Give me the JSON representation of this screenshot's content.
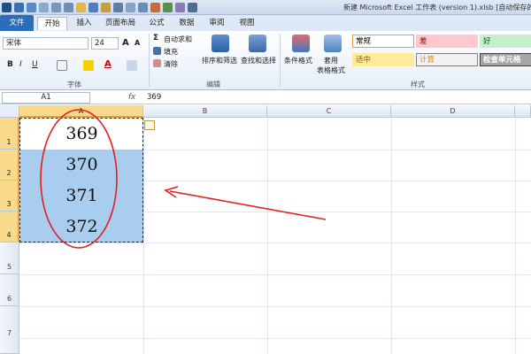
{
  "window": {
    "title": "新建 Microsoft Excel 工作表 (version 1).xlsb [自动保存的"
  },
  "tabs": [
    {
      "label": "文件"
    },
    {
      "label": "开始"
    },
    {
      "label": "插入"
    },
    {
      "label": "页面布局"
    },
    {
      "label": "公式"
    },
    {
      "label": "数据"
    },
    {
      "label": "审阅"
    },
    {
      "label": "视图"
    }
  ],
  "ribbon": {
    "font": {
      "name": "宋体",
      "size": "24",
      "grow": "A",
      "shrink": "A",
      "bold": "B",
      "italic": "I",
      "underline": "U",
      "color_letter": "A",
      "group_label": "字体"
    },
    "editing": {
      "autosum": "自动求和",
      "fill": "填充",
      "clear": "清除",
      "sort_filter": "排序和筛选",
      "find_select": "查找和选择",
      "group_label": "编辑"
    },
    "styles": {
      "conditional": "条件格式",
      "table_format_1": "套用",
      "table_format_2": "表格格式",
      "cells": [
        {
          "label": "常规",
          "bg": "#ffffff",
          "fg": "#000000",
          "border": "#e2a23b"
        },
        {
          "label": "差",
          "bg": "#ffc7ce",
          "fg": "#9c0006",
          "border": "#ffc7ce"
        },
        {
          "label": "好",
          "bg": "#c6efce",
          "fg": "#006100",
          "border": "#c6efce"
        },
        {
          "label": "适中",
          "bg": "#ffeb9c",
          "fg": "#9c5700",
          "border": "#ffeb9c"
        },
        {
          "label": "计算",
          "bg": "#f2f2f2",
          "fg": "#fa7d00",
          "border": "#7f7f7f"
        },
        {
          "label": "检查单元格",
          "bg": "#a5a5a5",
          "fg": "#ffffff",
          "border": "#3f3f3f"
        }
      ],
      "group_label": "样式"
    }
  },
  "formula_bar": {
    "name_box": "A1",
    "fx": "fx",
    "value": "369"
  },
  "sheet": {
    "columns": [
      "A",
      "B",
      "C",
      "D"
    ],
    "rows": [
      "1",
      "2",
      "3",
      "4",
      "5",
      "6",
      "7"
    ],
    "cells": [
      {
        "ref": "A1",
        "value": "369"
      },
      {
        "ref": "A2",
        "value": "370"
      },
      {
        "ref": "A3",
        "value": "371"
      },
      {
        "ref": "A4",
        "value": "372"
      }
    ]
  },
  "colors": {
    "accent": "#2a6ebb",
    "selection_fill": "#a9cdee",
    "header_selected": "#f9d98b",
    "annotation": "#e02020"
  },
  "icons": [
    "save-icon",
    "undo-icon",
    "redo-icon",
    "paste-options-icon",
    "sort-filter-icon",
    "find-icon",
    "conditional-format-icon",
    "table-format-icon"
  ]
}
